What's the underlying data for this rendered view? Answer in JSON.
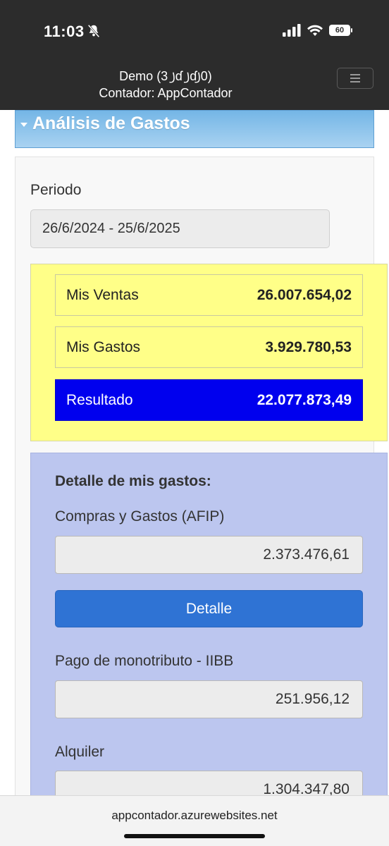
{
  "status": {
    "time": "11:03",
    "icons": [
      "bell-slash-icon",
      "signal-icon",
      "wifi-icon",
      "battery-icon"
    ],
    "battery_label": "60"
  },
  "header": {
    "line1": "Demo (3 ꠸ɗ ꠸ɗ꠸0)",
    "line2": "Contador: AppContador"
  },
  "section": {
    "title": "Análisis de Gastos"
  },
  "periodo": {
    "label": "Periodo",
    "value": "26/6/2024 - 25/6/2025"
  },
  "summary": {
    "ventas_label": "Mis Ventas",
    "ventas_value": "26.007.654,02",
    "gastos_label": "Mis Gastos",
    "gastos_value": "3.929.780,53",
    "resultado_label": "Resultado",
    "resultado_value": "22.077.873,49"
  },
  "gastos": {
    "heading": "Detalle de mis gastos:",
    "items": [
      {
        "label": "Compras y Gastos (AFIP)",
        "value": "2.373.476,61"
      },
      {
        "label": "Pago de monotributo - IIBB",
        "value": "251.956,12"
      },
      {
        "label": "Alquiler",
        "value": "1.304.347,80"
      }
    ],
    "detalle_button": "Detalle"
  },
  "browser": {
    "url": "appcontador.azurewebsites.net"
  },
  "colors": {
    "summary_bg": "#ffff88",
    "resultado_bg": "#0000ee",
    "gastos_bg": "#bcc6ef",
    "button_bg": "#2f73d4",
    "title_bar": "#74b6e6"
  }
}
